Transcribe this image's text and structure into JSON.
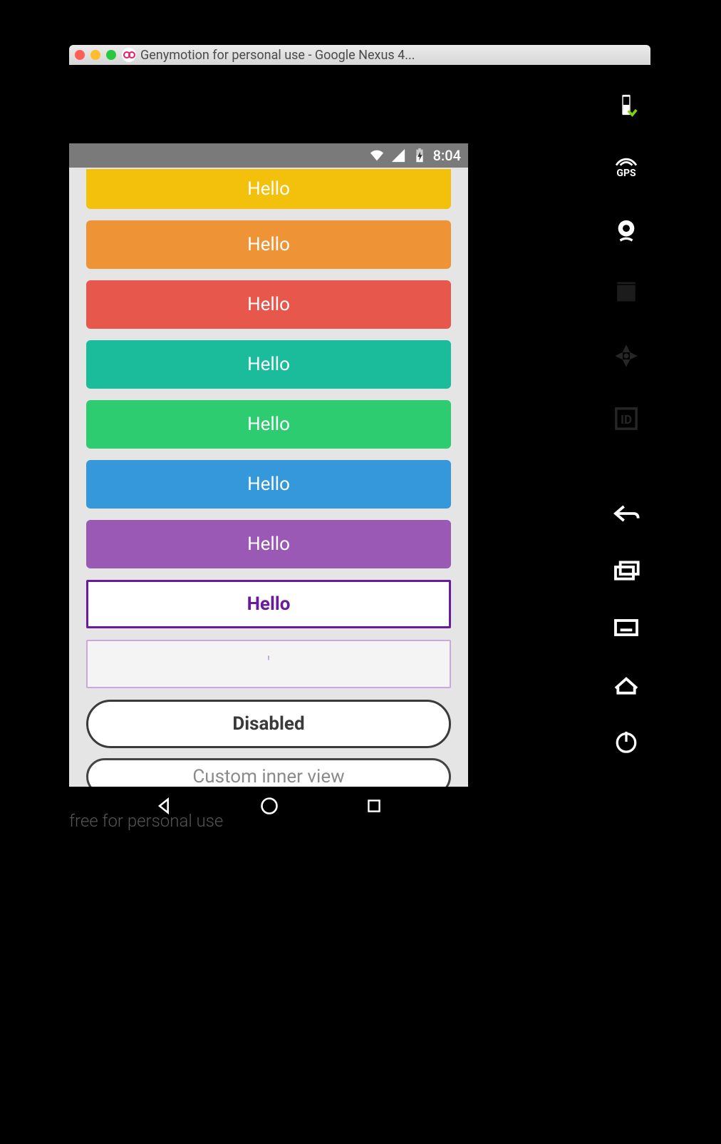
{
  "window": {
    "title": "Genymotion for personal use - Google Nexus 4..."
  },
  "statusbar": {
    "time": "8:04"
  },
  "buttons": {
    "yellow": "Hello",
    "orange": "Hello",
    "red": "Hello",
    "teal": "Hello",
    "green": "Hello",
    "blue": "Hello",
    "purple": "Hello",
    "outline_purple": "Hello",
    "outline_light": "'",
    "disabled": "Disabled",
    "custom": "Custom inner view"
  },
  "watermark": "free for personal use",
  "gm_sidebar": {
    "gps_label": "GPS",
    "id_label": "ID"
  }
}
